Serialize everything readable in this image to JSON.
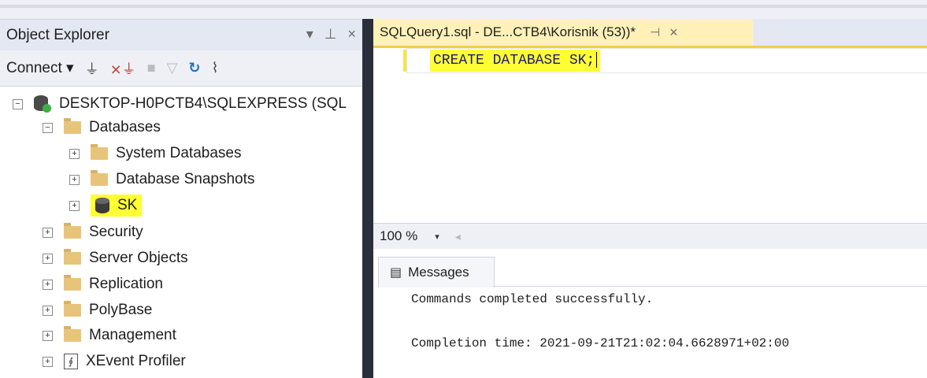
{
  "object_explorer": {
    "title": "Object Explorer",
    "controls": [
      "▾",
      "⊥",
      "×"
    ],
    "toolbar": {
      "connect_label": "Connect ▾"
    },
    "tree": {
      "server": "DESKTOP-H0PCTB4\\SQLEXPRESS (SQL",
      "databases": "Databases",
      "system_databases": "System Databases",
      "database_snapshots": "Database Snapshots",
      "sk": "SK",
      "security": "Security",
      "server_objects": "Server Objects",
      "replication": "Replication",
      "polybase": "PolyBase",
      "management": "Management",
      "xevent_profiler": "XEvent Profiler"
    }
  },
  "editor": {
    "tab_title": "SQLQuery1.sql - DE...CTB4\\Korisnik (53))*",
    "tab_pin": "⊣",
    "tab_close": "×",
    "code": "CREATE DATABASE SK;",
    "zoom": "100 %",
    "zoom_dropdown": "▾",
    "scroll_left": "◂"
  },
  "results": {
    "tab_label": "Messages",
    "lines": [
      "Commands completed successfully.",
      "Completion time: 2021-09-21T21:02:04.6628971+02:00"
    ]
  },
  "colors": {
    "highlight": "#ffff33",
    "folder": "#e8c47a",
    "active_tab": "#fff1b8",
    "splitter": "#2b2e3b"
  }
}
